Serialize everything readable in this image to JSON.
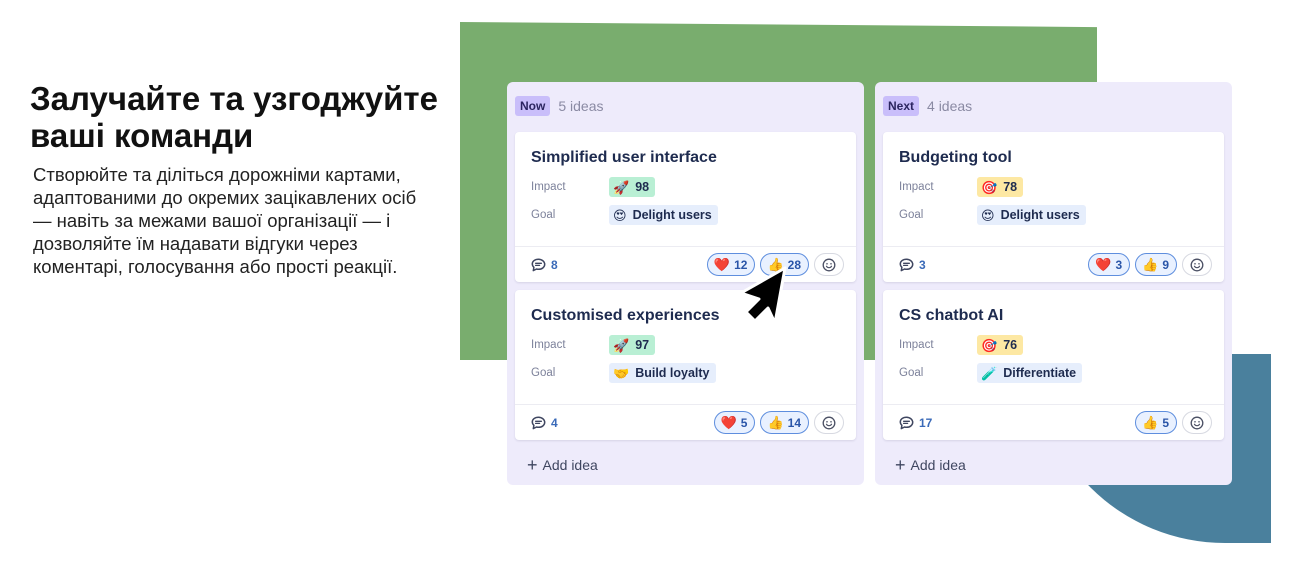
{
  "hero": {
    "title": "Залучайте та узгоджуйте ваші команди",
    "text": "Створюйте та діліться дорожніми картами, адаптованими до окремих зацікавлених осіб — навіть за межами вашої організації — і дозволяйте їм надавати відгуки через коментарі, голосування або прості реакції."
  },
  "colors": {
    "green_shape": "#79ad6e",
    "blue_shape": "#4a809d",
    "column_bg": "#eeebfb",
    "tag_bg": "#c9befa",
    "reaction_border": "#5e8ede"
  },
  "board": {
    "add_idea_label": "Add idea",
    "impact_label": "Impact",
    "goal_label": "Goal",
    "columns": [
      {
        "tag": "Now",
        "count": "5 ideas",
        "cards": [
          {
            "title": "Simplified user interface",
            "impact": {
              "icon": "rocket-icon",
              "value": "98"
            },
            "goal": {
              "icon": "heart-eyes-icon",
              "value": "Delight users"
            },
            "comments": "8",
            "reactions": {
              "heart": "12",
              "thumbs": "28"
            }
          },
          {
            "title": "Customised experiences",
            "impact": {
              "icon": "rocket-icon",
              "value": "97"
            },
            "goal": {
              "icon": "handshake-icon",
              "value": "Build loyalty"
            },
            "comments": "4",
            "reactions": {
              "heart": "5",
              "thumbs": "14"
            }
          }
        ]
      },
      {
        "tag": "Next",
        "count": "4 ideas",
        "cards": [
          {
            "title": "Budgeting tool",
            "impact": {
              "icon": "target-icon",
              "value": "78"
            },
            "goal": {
              "icon": "heart-eyes-icon",
              "value": "Delight users"
            },
            "comments": "3",
            "reactions": {
              "heart": "3",
              "thumbs": "9"
            }
          },
          {
            "title": "CS chatbot AI",
            "impact": {
              "icon": "target-icon",
              "value": "76"
            },
            "goal": {
              "icon": "test-tube-icon",
              "value": "Differentiate"
            },
            "comments": "17",
            "reactions": {
              "thumbs": "5"
            }
          }
        ]
      }
    ]
  }
}
